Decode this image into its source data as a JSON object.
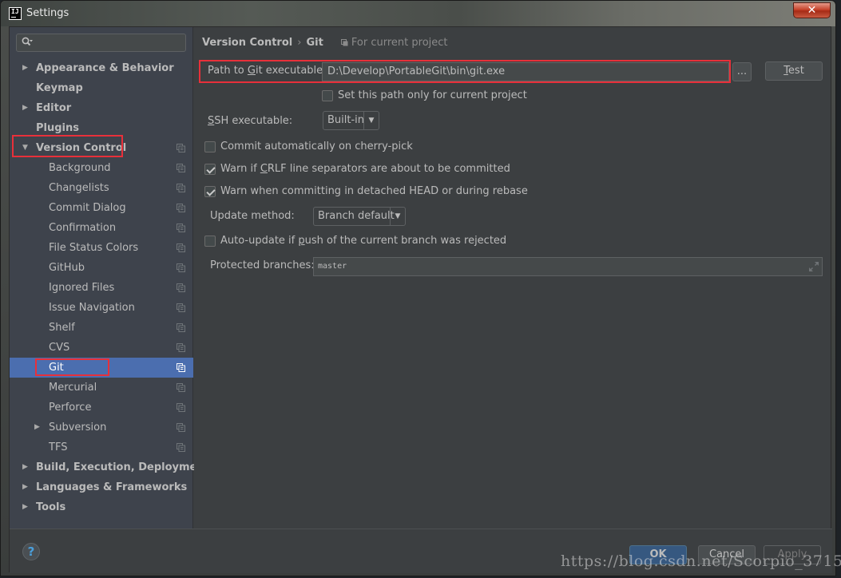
{
  "window": {
    "title": "Settings",
    "app_icon_label": "IJ",
    "close_glyph": "✕"
  },
  "sidebar": {
    "search_placeholder": "",
    "items": [
      {
        "label": "Appearance & Behavior",
        "level": 0,
        "expandable": true,
        "expanded": false,
        "arrow": "▶"
      },
      {
        "label": "Keymap",
        "level": 0,
        "expandable": false
      },
      {
        "label": "Editor",
        "level": 0,
        "expandable": true,
        "expanded": false,
        "arrow": "▶"
      },
      {
        "label": "Plugins",
        "level": 0,
        "expandable": false
      },
      {
        "label": "Version Control",
        "level": 0,
        "expandable": true,
        "expanded": true,
        "arrow": "▼",
        "project_icon": true,
        "highlighted": true
      },
      {
        "label": "Background",
        "level": 1,
        "project_icon": true
      },
      {
        "label": "Changelists",
        "level": 1,
        "project_icon": true
      },
      {
        "label": "Commit Dialog",
        "level": 1,
        "project_icon": true
      },
      {
        "label": "Confirmation",
        "level": 1,
        "project_icon": true
      },
      {
        "label": "File Status Colors",
        "level": 1,
        "project_icon": true
      },
      {
        "label": "GitHub",
        "level": 1,
        "project_icon": true
      },
      {
        "label": "Ignored Files",
        "level": 1,
        "project_icon": true
      },
      {
        "label": "Issue Navigation",
        "level": 1,
        "project_icon": true
      },
      {
        "label": "Shelf",
        "level": 1,
        "project_icon": true
      },
      {
        "label": "CVS",
        "level": 1,
        "project_icon": true
      },
      {
        "label": "Git",
        "level": 1,
        "project_icon": true,
        "selected": true,
        "highlighted": true
      },
      {
        "label": "Mercurial",
        "level": 1,
        "project_icon": true
      },
      {
        "label": "Perforce",
        "level": 1,
        "project_icon": true
      },
      {
        "label": "Subversion",
        "level": 1,
        "expandable": true,
        "arrow": "▶",
        "project_icon": true
      },
      {
        "label": "TFS",
        "level": 1,
        "project_icon": true
      },
      {
        "label": "Build, Execution, Deployment",
        "level": 0,
        "expandable": true,
        "arrow": "▶"
      },
      {
        "label": "Languages & Frameworks",
        "level": 0,
        "expandable": true,
        "arrow": "▶"
      },
      {
        "label": "Tools",
        "level": 0,
        "expandable": true,
        "arrow": "▶"
      }
    ]
  },
  "content": {
    "breadcrumb": {
      "parent": "Version Control",
      "separator": "›",
      "current": "Git",
      "scope_note": "For current project"
    },
    "path_to_git": {
      "label_prefix": "Path to ",
      "label_mnemonic": "G",
      "label_suffix": "it executable:",
      "value": "D:\\Develop\\PortableGit\\bin\\git.exe",
      "browse_label": "...",
      "test_mnemonic": "T",
      "test_suffix": "est"
    },
    "set_path_only_current": {
      "label": "Set this path only for current project",
      "checked": false
    },
    "ssh_executable": {
      "label_mnemonic": "S",
      "label_suffix": "SH executable:",
      "value": "Built-in",
      "arrow": "▼"
    },
    "commit_cherry_pick": {
      "label": "Commit automatically on cherry-pick",
      "checked": false
    },
    "warn_crlf": {
      "label_prefix": "Warn if ",
      "label_mnemonic": "C",
      "label_suffix": "RLF line separators are about to be committed",
      "checked": true
    },
    "warn_detached": {
      "label": "Warn when committing in detached HEAD or during rebase",
      "checked": true
    },
    "update_method": {
      "label": "Update method:",
      "value": "Branch default",
      "arrow": "▼"
    },
    "auto_update": {
      "label_prefix": "Auto-update if ",
      "label_mnemonic": "p",
      "label_suffix": "ush of the current branch was rejected",
      "checked": false
    },
    "protected_branches": {
      "label": "Protected branches:",
      "value": "master"
    }
  },
  "footer": {
    "help_label": "?",
    "ok_label": "OK",
    "cancel_label": "Cancel",
    "apply_label": "Apply"
  },
  "watermark": "https://blog.csdn.net/Scorpio_3715",
  "colors": {
    "accent_selected": "#4b6eaf",
    "highlight_box": "#e8303a",
    "ok_button": "#365880"
  }
}
